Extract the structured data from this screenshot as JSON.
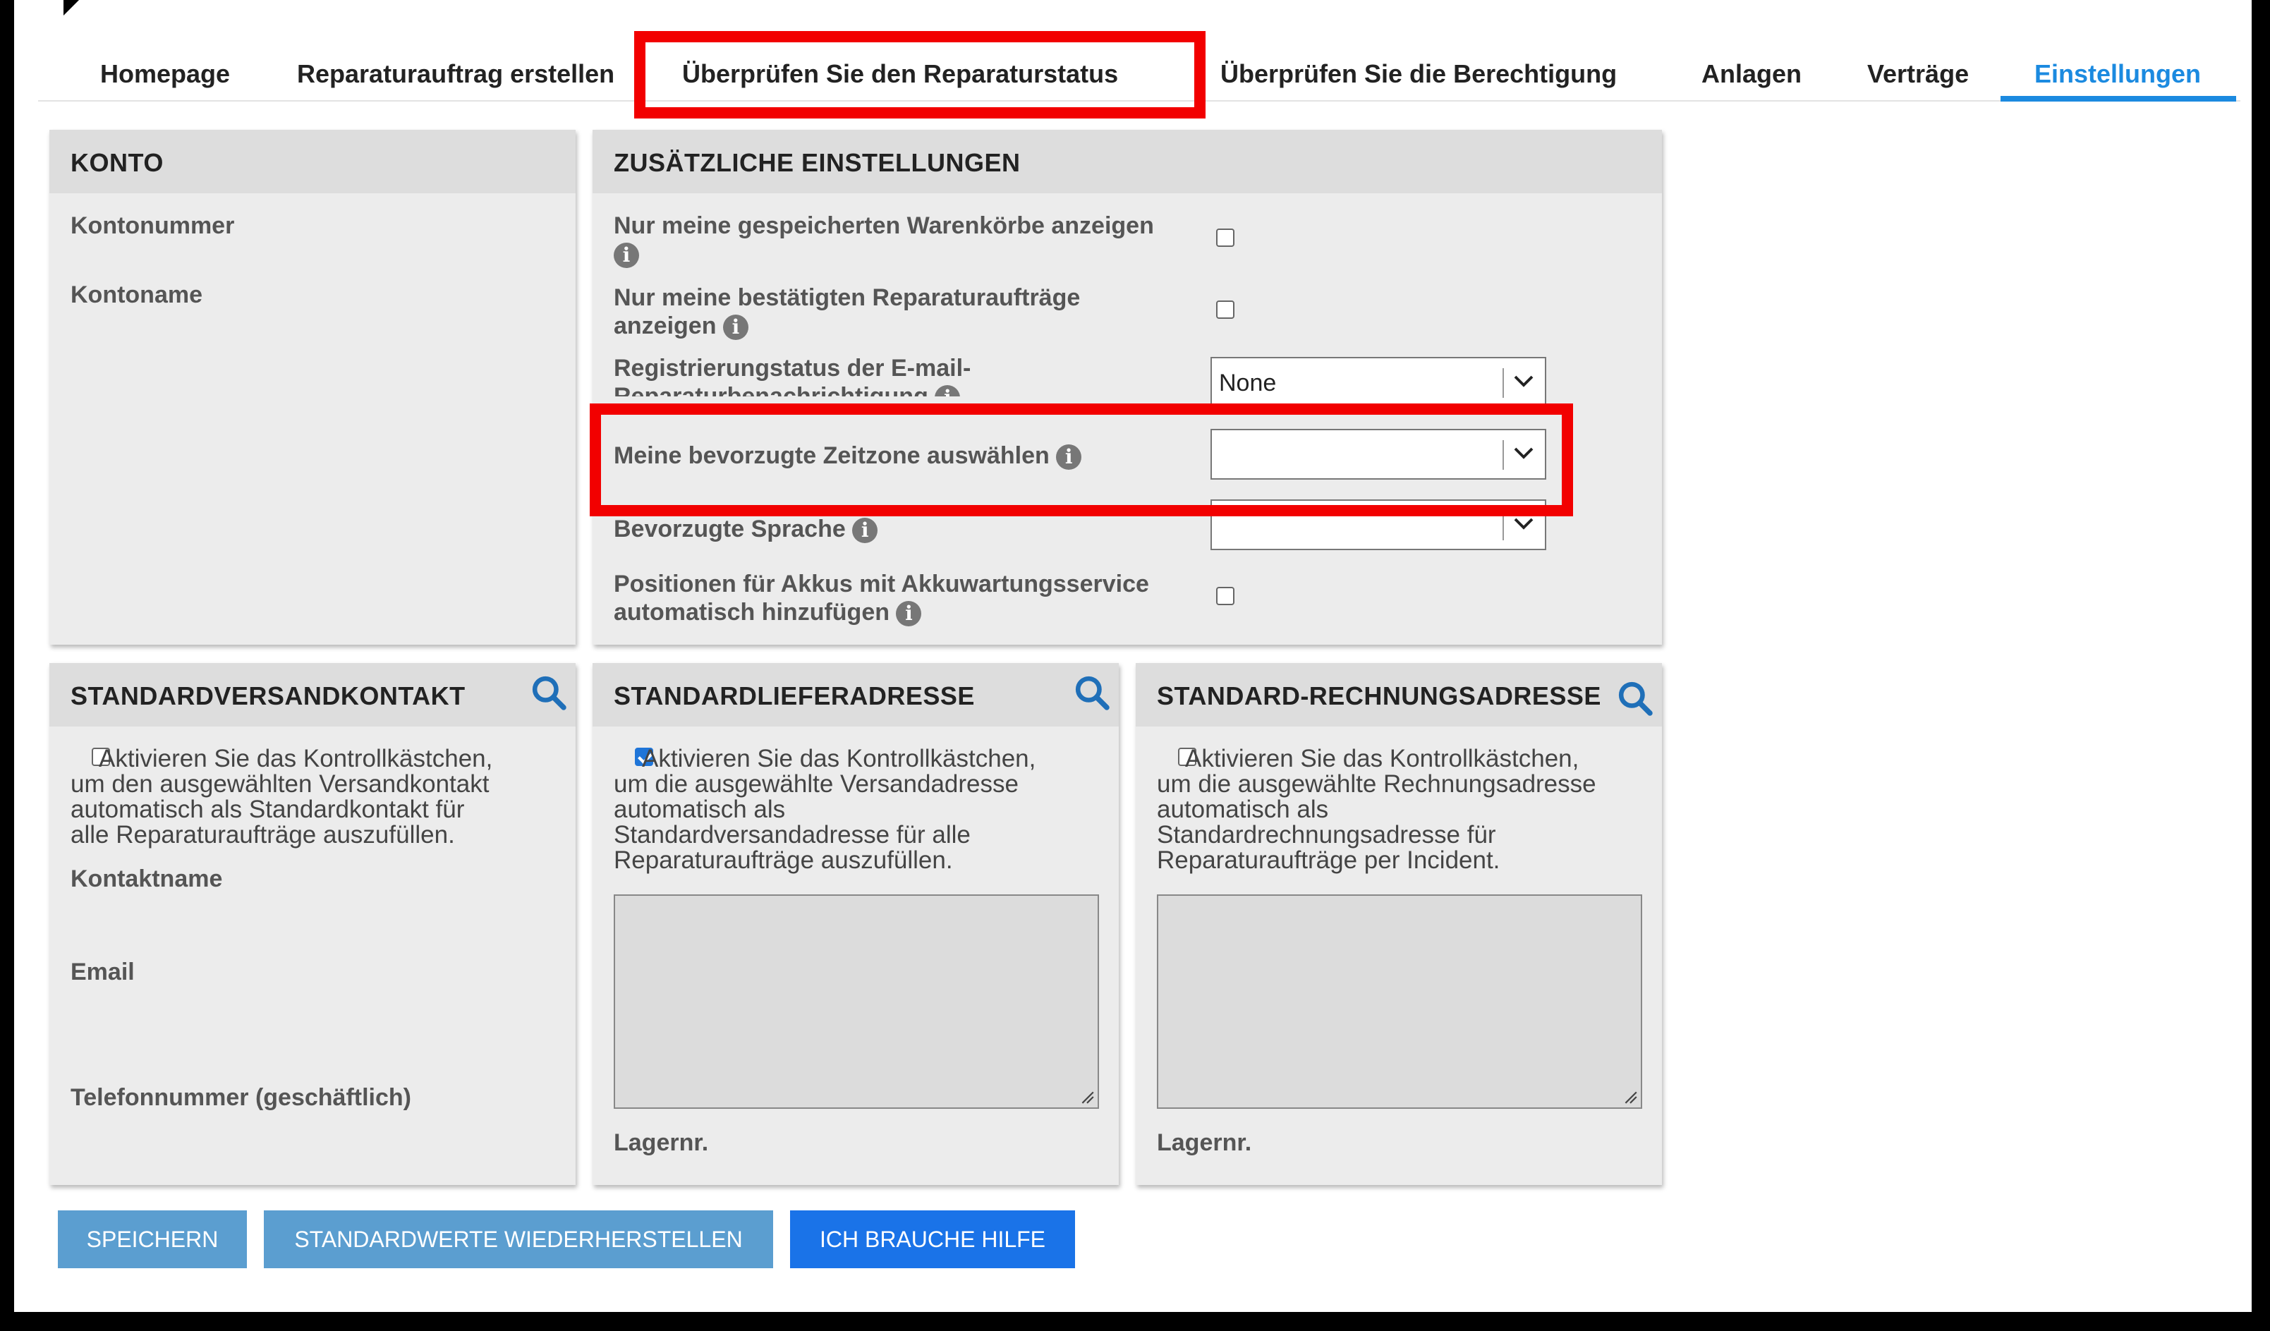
{
  "tabs": [
    {
      "label": "Homepage"
    },
    {
      "label": "Reparaturauftrag erstellen"
    },
    {
      "label": "Überprüfen Sie den Reparaturstatus"
    },
    {
      "label": "Überprüfen Sie die Berechtigung"
    },
    {
      "label": "Anlagen"
    },
    {
      "label": "Verträge"
    },
    {
      "label": "Einstellungen"
    }
  ],
  "active_tab": "Einstellungen",
  "account": {
    "title": "KONTO",
    "account_number_label": "Kontonummer",
    "account_name_label": "Kontoname"
  },
  "additional": {
    "title": "ZUSÄTZLICHE EINSTELLUNGEN",
    "saved_carts_label": "Nur meine gespeicherten Warenkörbe anzeigen",
    "saved_carts_checked": false,
    "confirmed_orders_label_1": "Nur meine bestätigten Reparaturaufträge",
    "confirmed_orders_label_2": "anzeigen",
    "confirmed_orders_checked": false,
    "email_status_label_1": "Registrierungstatus der E-mail-",
    "email_status_label_2": "Reparaturbenachrichtigung",
    "email_status_value": "None",
    "timezone_label": "Meine bevorzugte Zeitzone auswählen",
    "timezone_value": "",
    "language_label": "Bevorzugte Sprache",
    "language_value": "",
    "battery_label_1": "Positionen für Akkus mit Akkuwartungsservice",
    "battery_label_2": "automatisch hinzufügen",
    "battery_checked": false
  },
  "shipping_contact": {
    "title": "STANDARDVERSANDKONTAKT",
    "checkbox_checked": false,
    "text_lines": [
      "Aktivieren Sie das Kontrollkästchen,",
      "um den ausgewählten Versandkontakt",
      "automatisch als Standardkontakt für",
      "alle Reparaturaufträge auszufüllen."
    ],
    "contact_name_label": "Kontaktname",
    "email_label": "Email",
    "phone_label": "Telefonnummer (geschäftlich)"
  },
  "delivery_address": {
    "title": "STANDARDLIEFERADRESSE",
    "checkbox_checked": true,
    "text_lines": [
      "Aktivieren Sie das Kontrollkästchen,",
      "um die ausgewählte Versandadresse",
      "automatisch als",
      "Standardversandadresse für alle",
      "Reparaturaufträge auszufüllen."
    ],
    "storage_label": "Lagernr."
  },
  "billing_address": {
    "title": "STANDARD-RECHNUNGSADRESSE",
    "checkbox_checked": false,
    "text_lines": [
      "Aktivieren Sie das Kontrollkästchen,",
      "um die ausgewählte Rechnungsadresse",
      "automatisch als",
      "Standardrechnungsadresse für",
      "Reparaturaufträge per Incident."
    ],
    "storage_label": "Lagernr."
  },
  "buttons": {
    "save": "SPEICHERN",
    "restore": "STANDARDWERTE WIEDERHERSTELLEN",
    "help": "ICH BRAUCHE HILFE"
  },
  "colors": {
    "accent": "#1b8ae0",
    "highlight": "#f20000",
    "button_light": "#5b9ed0",
    "button_primary": "#1a73e8"
  }
}
